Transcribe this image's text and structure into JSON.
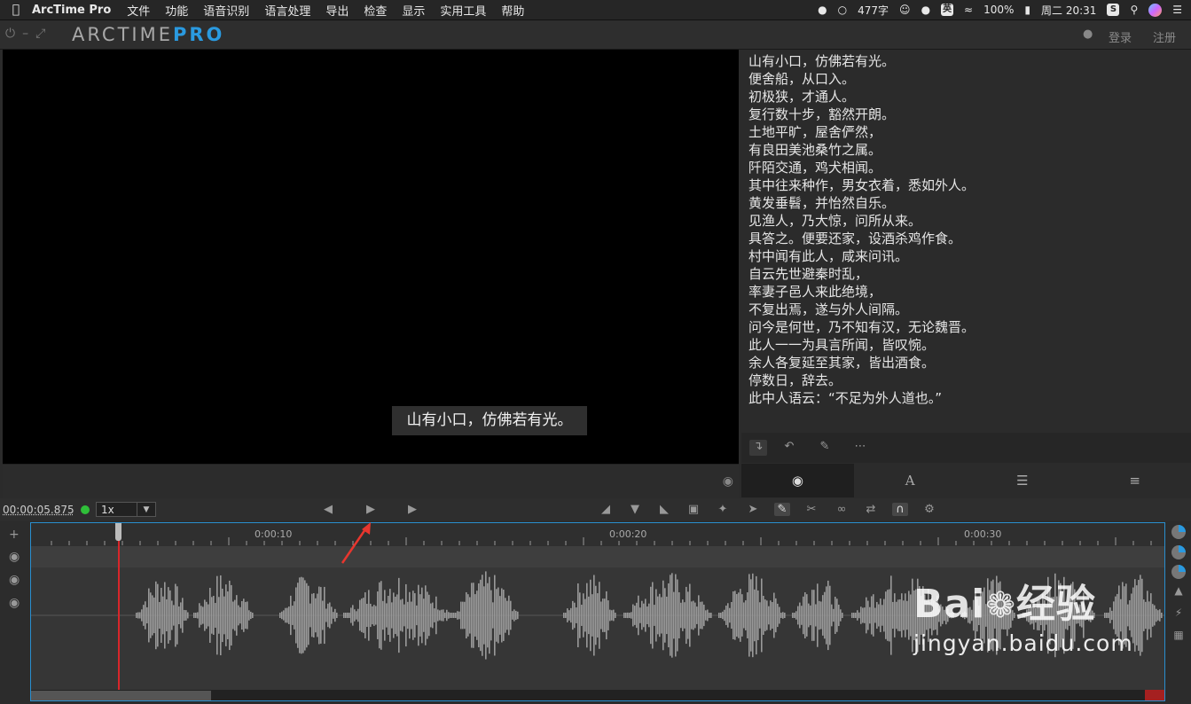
{
  "menubar": {
    "app_name": "ArcTime Pro",
    "menus": [
      "文件",
      "功能",
      "语音识别",
      "语言处理",
      "导出",
      "检查",
      "显示",
      "实用工具",
      "帮助"
    ],
    "word_count": "477字",
    "input_method": "英",
    "battery": "100%",
    "clock": "周二 20:31"
  },
  "titlebar": {
    "logo_part1": "ARCTIME",
    "logo_part2": "PRO",
    "login": "登录",
    "register": "注册"
  },
  "video": {
    "current_subtitle": "山有小口，仿佛若有光。"
  },
  "subtitle_lines": [
    "山有小口，仿佛若有光。",
    "便舍船，从口入。",
    "初极狭，才通人。",
    "复行数十步，豁然开朗。",
    "土地平旷，屋舍俨然，",
    "有良田美池桑竹之属。",
    "阡陌交通，鸡犬相闻。",
    "其中往来种作，男女衣着，悉如外人。",
    "黄发垂髫，并怡然自乐。",
    "见渔人，乃大惊，问所从来。",
    "具答之。便要还家，设酒杀鸡作食。",
    "村中闻有此人，咸来问讯。",
    "自云先世避秦时乱，",
    "率妻子邑人来此绝境，",
    "不复出焉，遂与外人间隔。",
    "问今是何世，乃不知有汉，无论魏晋。",
    "此人一一为具言所闻，皆叹惋。",
    "余人各复延至其家，皆出酒食。",
    "停数日，辞去。",
    "此中人语云：“不足为外人道也。”"
  ],
  "tabs": {
    "font_glyph": "A"
  },
  "transport": {
    "timecode": "00:00:05.875",
    "speed": "1x"
  },
  "timeline": {
    "labels": [
      "0:00:10",
      "0:00:20",
      "0:00:30"
    ]
  },
  "watermark": {
    "brand_left": "Bai",
    "brand_right": "经验",
    "url": "jingyan.baidu.com"
  },
  "colors": {
    "accent_blue": "#2a9ae0",
    "playhead_red": "#d8262a",
    "status_green": "#2fbf39"
  }
}
